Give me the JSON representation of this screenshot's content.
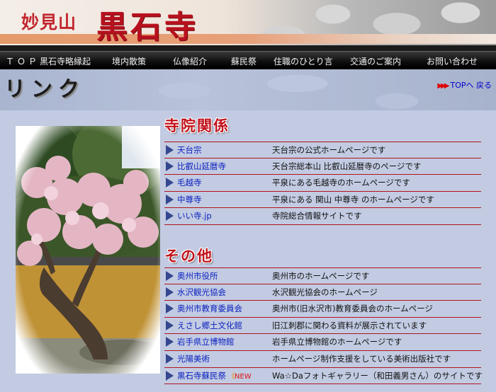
{
  "header": {
    "subtitle": "妙見山",
    "title": "黒石寺"
  },
  "nav": {
    "items": [
      "ＴＯＰ",
      "黒石寺略縁起",
      "境内散策",
      "仏像紹介",
      "蘇民祭",
      "住職のひとり言",
      "交通のご案内",
      "お問い合わせ"
    ]
  },
  "page": {
    "title": "リンク",
    "top_link": "TOPへ 戻る"
  },
  "sections": [
    {
      "heading": "寺院関係",
      "rows": [
        {
          "name": "天台宗",
          "desc": "天台宗の公式ホームページです"
        },
        {
          "name": "比叡山延暦寺",
          "desc": "天台宗総本山 比叡山延暦寺のページです"
        },
        {
          "name": "毛越寺",
          "desc": "平泉にある毛越寺のホームページです"
        },
        {
          "name": "中尊寺",
          "desc": "平泉にある 関山 中尊寺 のホームページです"
        },
        {
          "name": "いい寺.jp",
          "desc": "寺院総合情報サイトです"
        }
      ]
    },
    {
      "heading": "その他",
      "rows": [
        {
          "name": "奥州市役所",
          "desc": "奥州市のホームページです"
        },
        {
          "name": "水沢観光協会",
          "desc": "水沢観光協会のホームページ"
        },
        {
          "name": "奥州市教育委員会",
          "desc": "奥州市(旧水沢市)教育委員会のホームページ"
        },
        {
          "name": "えさし郷土文化館",
          "desc": "旧江刺郡に関わる資料が展示されています"
        },
        {
          "name": "岩手県立博物館",
          "desc": "岩手県立博物館のホームページです"
        },
        {
          "name": "光陽美術",
          "desc": "ホームページ制作支援をしている美術出版社です"
        },
        {
          "name": "黒石寺蘇民祭",
          "badge": "NEW",
          "desc": "Wa☆Daフォトギャラリー（和田義男さん）のサイトです"
        }
      ]
    }
  ]
}
